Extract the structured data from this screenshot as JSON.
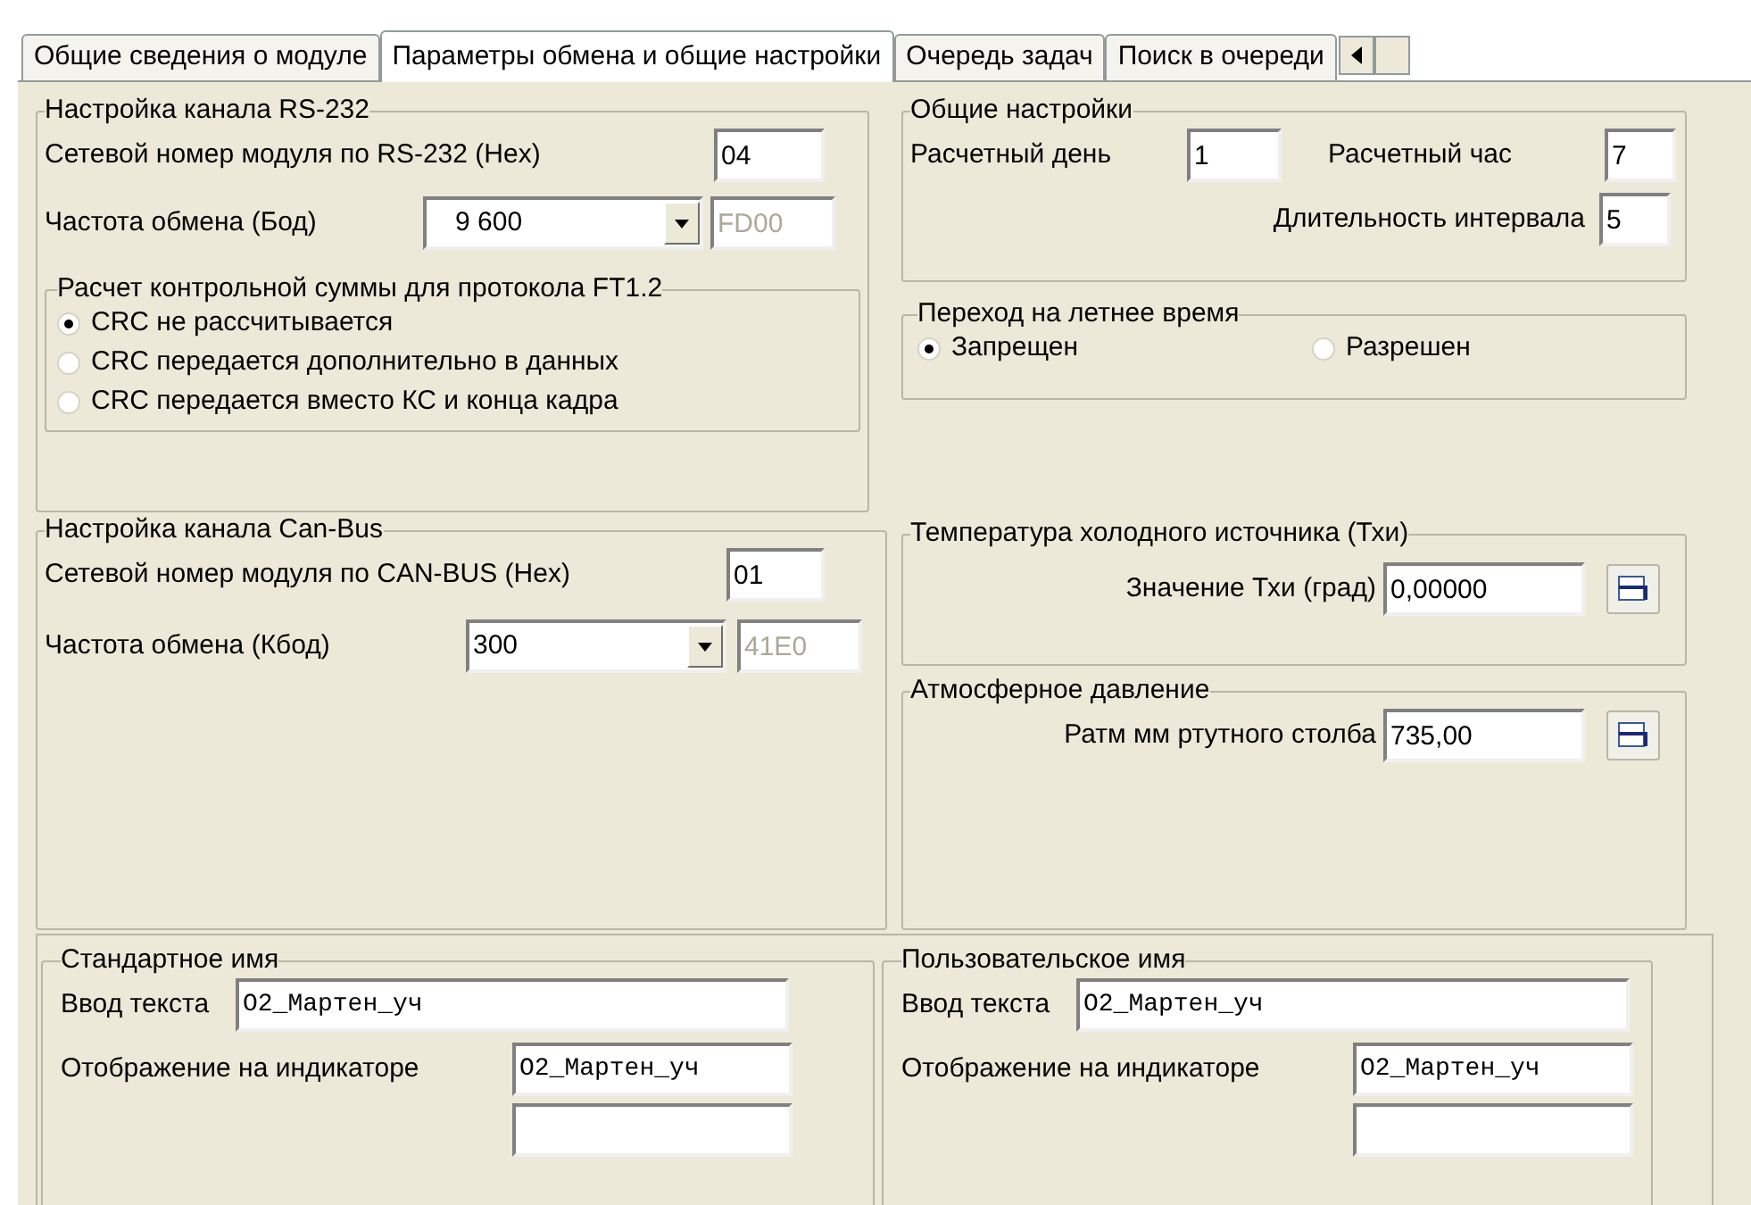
{
  "tabs": [
    {
      "label": "Общие сведения о модуле",
      "selected": false
    },
    {
      "label": "Параметры обмена и общие настройки",
      "selected": true
    },
    {
      "label": "Очередь задач",
      "selected": false
    },
    {
      "label": "Поиск в очереди",
      "selected": false
    }
  ],
  "rs232": {
    "title": "Настройка канала RS-232",
    "address": {
      "label": "Сетевой номер модуля  по RS-232 (Hex)",
      "value": "04"
    },
    "baud": {
      "label": "Частота обмена (Бод)",
      "value": "9 600",
      "code": "FD00",
      "code_disabled": true
    },
    "checksum": {
      "title": "Расчет контрольной суммы для протокола FT1.2",
      "options": [
        {
          "label": "CRC не рассчитывается",
          "selected": true
        },
        {
          "label": "CRC передается дополнительно в данных",
          "selected": false
        },
        {
          "label": "CRC передается вместо КС и конца кадра",
          "selected": false
        }
      ]
    }
  },
  "general": {
    "title": "Общие настройки",
    "day": {
      "label": "Расчетный день",
      "value": "1"
    },
    "hour": {
      "label": "Расчетный час",
      "value": "7"
    },
    "interval": {
      "label": "Длительность интервала",
      "value": "5"
    }
  },
  "dst": {
    "title": "Переход на летнее время",
    "options": [
      {
        "label": "Запрещен",
        "selected": true
      },
      {
        "label": "Разрешен",
        "selected": false
      }
    ]
  },
  "canbus": {
    "title": "Настройка канала Can-Bus",
    "address": {
      "label": "Сетевой номер модуля по  CAN-BUS  (Hex)",
      "value": "01"
    },
    "rate": {
      "label": "Частота обмена (Кбод)",
      "value": "300",
      "code": "41E0",
      "code_disabled": true
    }
  },
  "cold_source": {
    "title": "Температура холодного источника (Тхи)",
    "label": "Значение Тхи (град)",
    "value": "0,00000"
  },
  "pressure": {
    "title": "Атмосферное давление",
    "label": "Ратм мм ртутного столба",
    "value": "735,00"
  },
  "names": [
    {
      "title": "Стандартное имя",
      "input_label": "Ввод текста",
      "input_value": "O2_Мартен_уч",
      "display_label": "Отображение на индикаторе",
      "display_value": "O2_Мартен_уч"
    },
    {
      "title": "Пользовательское имя",
      "input_label": "Ввод текста",
      "input_value": "O2_Мартен_уч",
      "display_label": "Отображение на индикаторе",
      "display_value": "O2_Мартен_уч"
    }
  ]
}
